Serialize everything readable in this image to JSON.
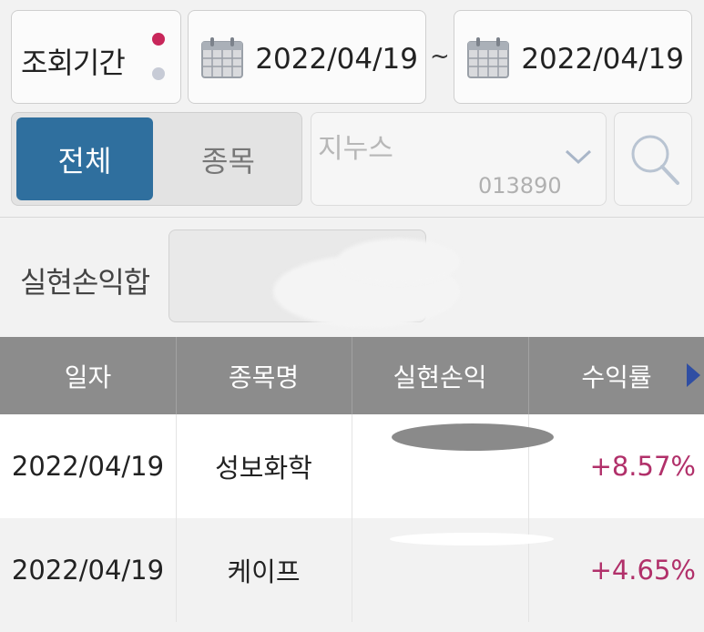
{
  "filter": {
    "period_label": "조회기간",
    "start_date": "2022/04/19",
    "separator": "~",
    "end_date": "2022/04/19",
    "dot_colors": [
      "#c8275a",
      "#c7cbd6"
    ]
  },
  "mode": {
    "all_label": "전체",
    "item_label": "종목",
    "selected": "전체"
  },
  "stock": {
    "name": "지누스",
    "code": "013890"
  },
  "summary": {
    "label": "실현손익합"
  },
  "table": {
    "columns": [
      "일자",
      "종목명",
      "실현손익",
      "수익률"
    ],
    "rows": [
      {
        "date": "2022/04/19",
        "name": "성보화학",
        "profit": "",
        "rate": "+8.57%"
      },
      {
        "date": "2022/04/19",
        "name": "케이프",
        "profit": "",
        "rate": "+4.65%"
      }
    ]
  },
  "colors": {
    "accent": "#2f6f9e",
    "header_bg": "#8c8c8c",
    "positive": "#b1306a"
  }
}
